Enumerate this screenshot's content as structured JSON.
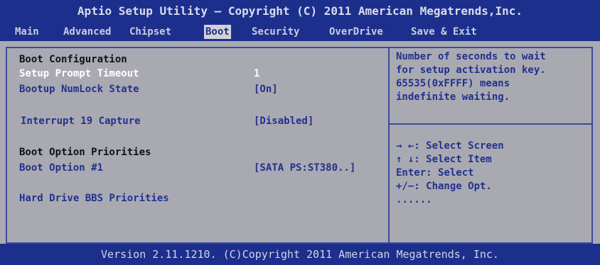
{
  "title": "Aptio Setup Utility – Copyright (C) 2011 American Megatrends,Inc.",
  "menu": [
    {
      "label": "Main"
    },
    {
      "label": "Advanced"
    },
    {
      "label": "Chipset"
    },
    {
      "label": "Boot",
      "active": true
    },
    {
      "label": "Security"
    },
    {
      "label": "OverDrive"
    },
    {
      "label": "Save & Exit"
    }
  ],
  "settings": {
    "boot_configuration_heading": "Boot Configuration",
    "setup_prompt_timeout": {
      "label": "Setup Prompt Timeout",
      "value": "1"
    },
    "bootup_numlock_state": {
      "label": "Bootup NumLock State",
      "value": "[On]"
    },
    "interrupt_19_capture": {
      "label": "Interrupt 19 Capture",
      "value": "[Disabled]"
    },
    "boot_option_priorities_heading": "Boot Option Priorities",
    "boot_option_1": {
      "label": "Boot Option #1",
      "value": "[SATA PS:ST380..]"
    },
    "hard_drive_bbs_priorities": {
      "label": "Hard Drive BBS Priorities"
    }
  },
  "help": {
    "lines": [
      "Number of seconds to wait",
      "for setup activation key.",
      "65535(0xFFFF) means",
      "indefinite waiting."
    ]
  },
  "keys": [
    "→ ←: Select Screen",
    "↑ ↓: Select Item",
    "Enter: Select",
    "+/−:  Change Opt.",
    "......"
  ],
  "footer": "Version 2.11.1210. (C)Copyright 2011 American Megatrends, Inc.",
  "colors": {
    "bar_background": "#1d2f8c",
    "panel_background": "#a9aab1",
    "item_text": "#22318f",
    "selected_text": "#ffffff",
    "active_tab_background": "#d2d2d6"
  }
}
